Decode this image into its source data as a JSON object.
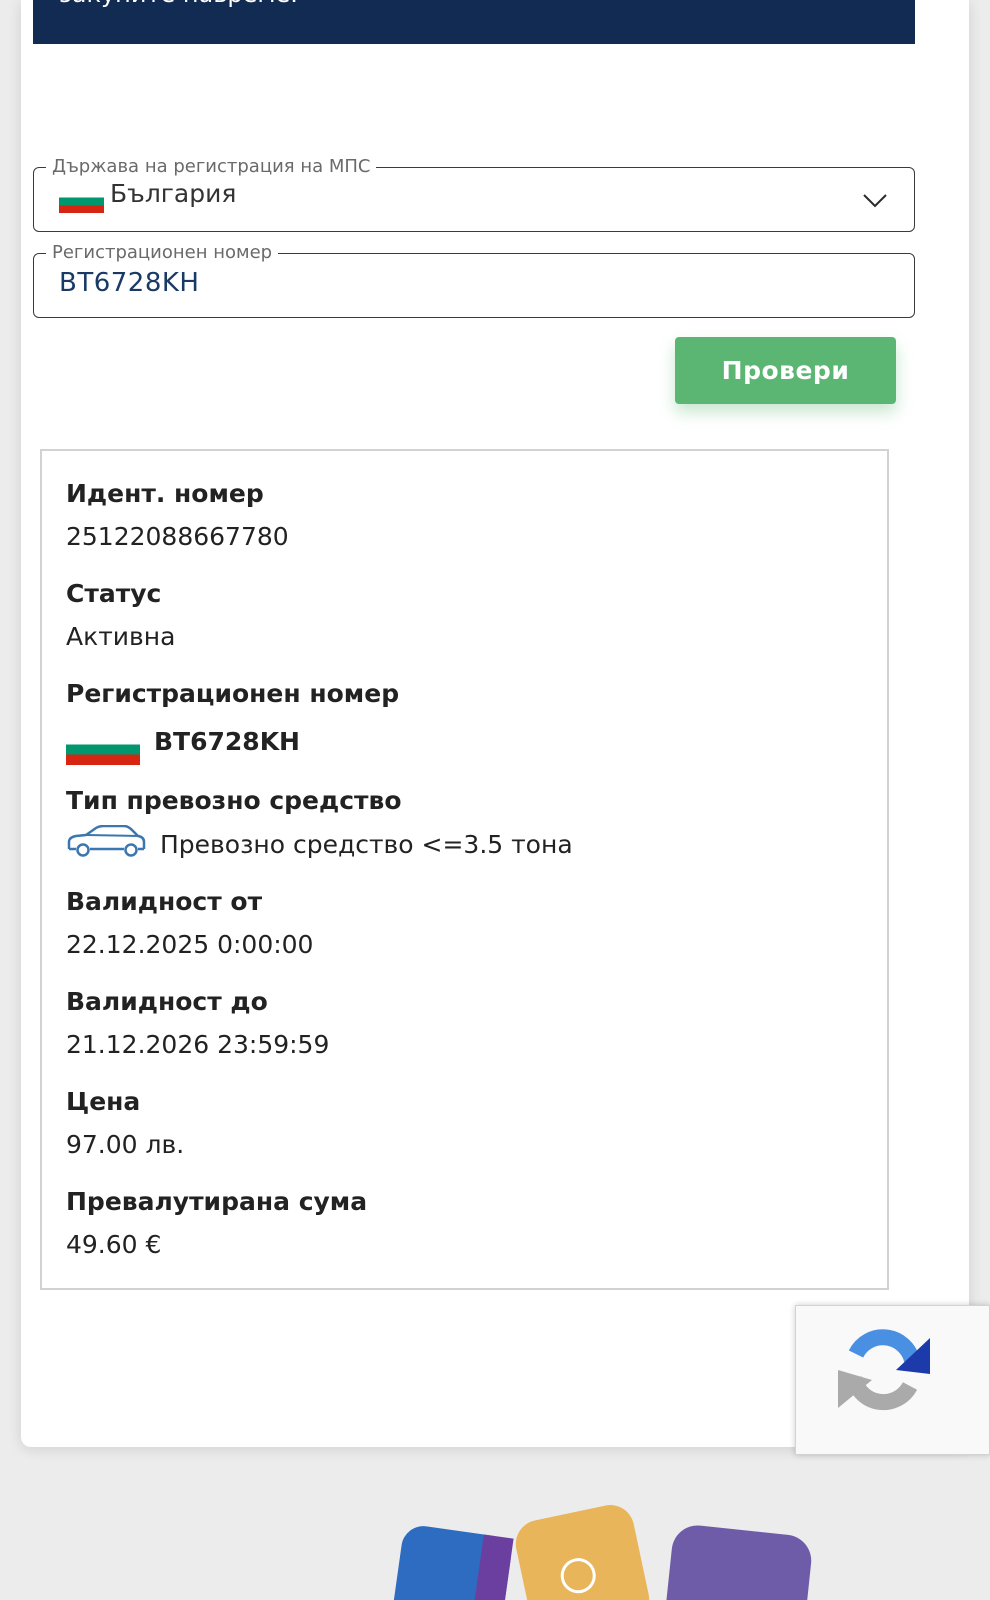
{
  "banner": {
    "text": "закупите навреме."
  },
  "country_field": {
    "legend": "Държава на регистрация на МПС",
    "value": "България"
  },
  "reg_field": {
    "legend": "Регистрационен номер",
    "value": "BT6728KH"
  },
  "check_button": {
    "label": "Провери"
  },
  "result": {
    "ident_label": "Идент. номер",
    "ident_value": "25122088667780",
    "status_label": "Статус",
    "status_value": "Активна",
    "reg_label": "Регистрационен номер",
    "reg_value": "BT6728KH",
    "type_label": "Тип превозно средство",
    "type_value": "Превозно средство <=3.5 тона",
    "valid_from_label": "Валидност от",
    "valid_from_value": "22.12.2025 0:00:00",
    "valid_to_label": "Валидност до",
    "valid_to_value": "21.12.2026 23:59:59",
    "price_label": "Цена",
    "price_value": "97.00 лв.",
    "converted_label": "Превалутирана сума",
    "converted_value": "49.60 €"
  },
  "icons": {
    "flag": "bulgaria-flag-icon",
    "chevron": "chevron-down-icon",
    "vehicle": "car-icon",
    "captcha": "recaptcha-logo-icon"
  },
  "colors": {
    "banner": "#122b52",
    "button": "#5bb673",
    "reg_text": "#1a3a66"
  }
}
